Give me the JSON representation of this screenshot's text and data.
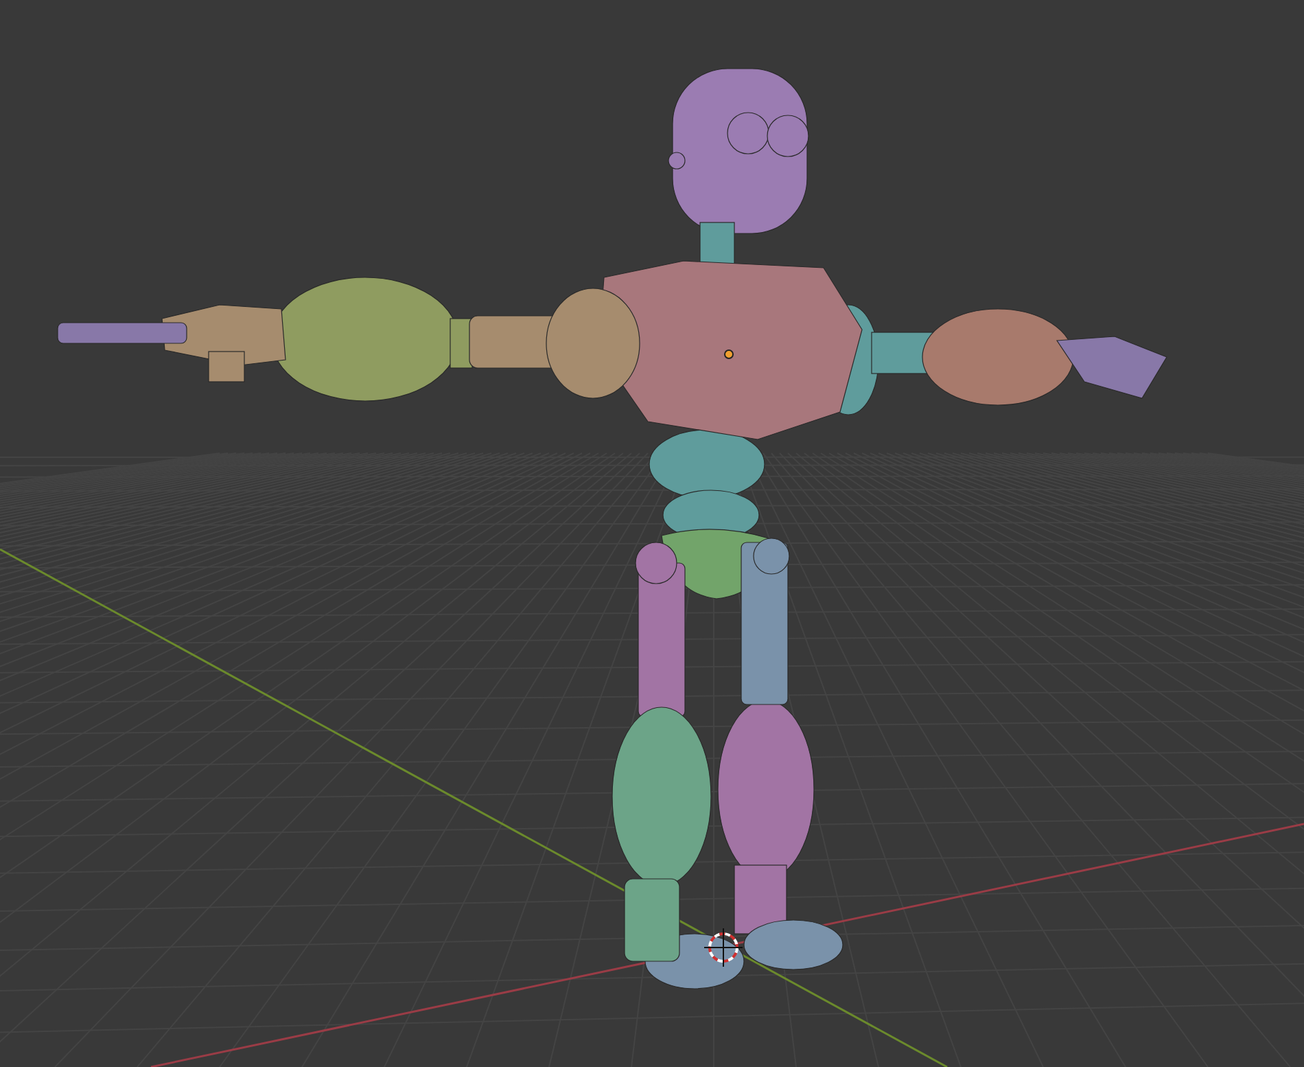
{
  "viewport": {
    "axes": [
      {
        "color": "#9a3c46"
      },
      {
        "color": "#6b8a2c"
      }
    ],
    "model": {
      "parts": [
        {
          "color": "#9b7cb2"
        },
        {
          "color": "#5f9c9c"
        },
        {
          "color": "#a8777c"
        },
        {
          "color": "#8f9c60"
        },
        {
          "color": "#a68c6e"
        },
        {
          "color": "#a87a6c"
        },
        {
          "color": "#72a46a"
        },
        {
          "color": "#a274a4"
        },
        {
          "color": "#7a92aa"
        },
        {
          "color": "#6ca488"
        },
        {
          "color": "#8878a8"
        }
      ]
    }
  }
}
